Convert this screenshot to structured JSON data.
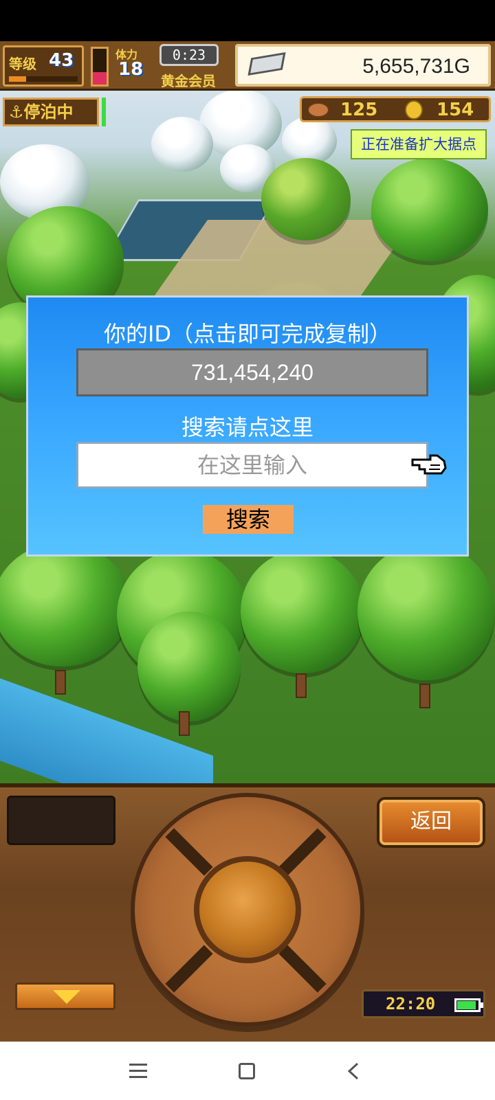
{
  "hud": {
    "level_label": "等级",
    "level_value": "43",
    "level_progress": 0.25,
    "stamina_label": "体力",
    "stamina_value": "18",
    "stamina_level": 0.35,
    "timer": "0:23",
    "member_label": "黄金会员",
    "gold_value": "5,655,731G",
    "anchor_status": "停泊中",
    "meat_value": "125",
    "coin_value": "154",
    "expand_notice": "正在准备扩大据点"
  },
  "dialog": {
    "title": "你的ID（点击即可完成复制）",
    "id_value": "731,454,240",
    "search_prompt": "搜索请点这里",
    "search_placeholder": "在这里输入",
    "search_button": "搜索"
  },
  "panel": {
    "back_button": "返回",
    "clock": "22:20",
    "battery_level": 0.85
  },
  "icons": {
    "anchor": "anchor-icon",
    "gold": "silver-bar-icon",
    "meat": "meat-icon",
    "coin": "coin-icon",
    "pointer": "pointing-hand-icon",
    "menu_toggle": "arrow-down-icon",
    "battery": "battery-icon"
  },
  "colors": {
    "dialog_top": "#1e8af2",
    "dialog_bottom": "#56c3ff",
    "search_button": "#f4a25a",
    "notice_bg": "#e6ff7a",
    "notice_text": "#1a34c8"
  }
}
